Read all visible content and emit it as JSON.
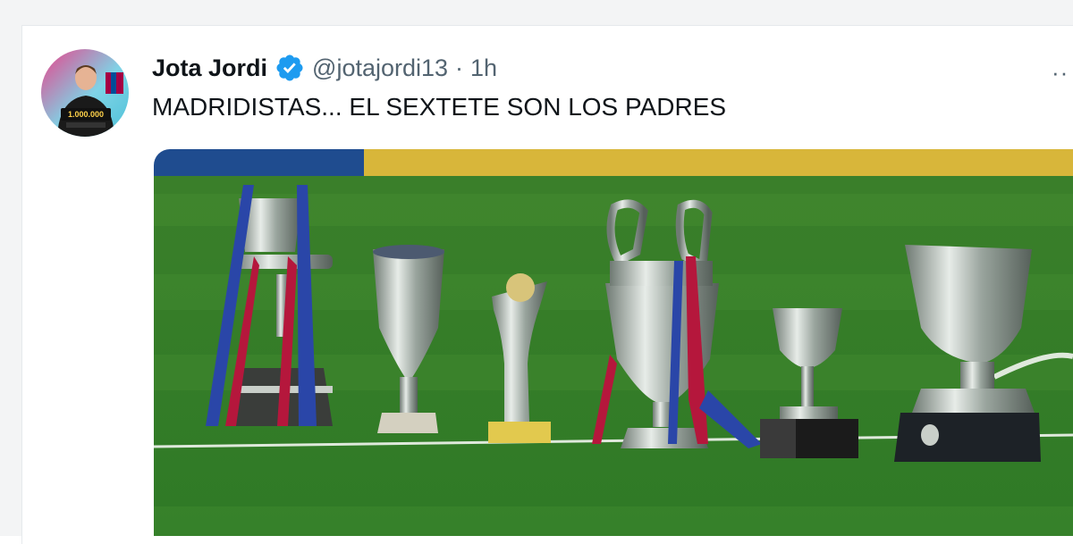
{
  "tweet": {
    "display_name": "Jota Jordi",
    "handle": "@jotajordi13",
    "separator": "·",
    "time": "1h",
    "text": "MADRIDISTAS... EL SEXTETE SON LOS PADRES",
    "more_label": "··"
  },
  "avatar": {
    "counter_text": "1.000.000"
  },
  "colors": {
    "verified": "#1d9bf0",
    "name": "#0f1419",
    "secondary": "#536471",
    "pitch": "#3f8f2e"
  },
  "icons": {
    "verified": "verified-badge-icon",
    "more": "more-options-icon"
  }
}
